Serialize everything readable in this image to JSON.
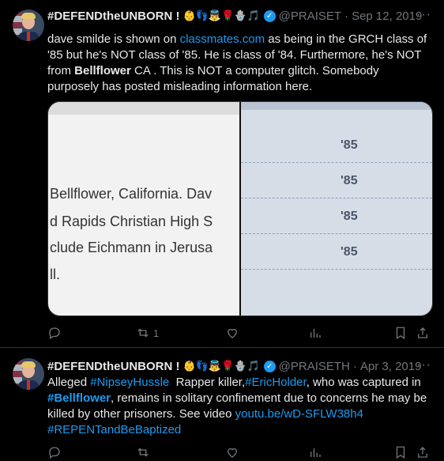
{
  "tweets": [
    {
      "name": "#DEFENDtheUNBORN !",
      "emojis": "👶👣👼🌹🪬🎵",
      "handle": "@PRAISET",
      "date": "Sep 12, 2019",
      "text_parts": [
        "dave smilde is shown on ",
        "classmates.com",
        " as being in the GRCH class of '85 but he's NOT class of '85. He is class of '84. Furthermore, he's NOT from ",
        "Bellflower",
        " CA . This is NOT a computer glitch. Somebody purposely has posted misleading information here."
      ],
      "media": {
        "left_lines": [
          "Bellflower, California. Dav",
          "d Rapids Christian High S",
          "clude Eichmann in Jerusa",
          "ll."
        ],
        "right_years": [
          "'85",
          "'85",
          "'85",
          "'85"
        ]
      },
      "retweet_count": "1"
    },
    {
      "name": "#DEFENDtheUNBORN !",
      "emojis": "👶👣👼🌹🪬🎵",
      "handle": "@PRAISETH",
      "date": "Apr 3, 2019",
      "text_parts": [
        "Alleged ",
        "#NipseyHussle",
        "  Rapper killer,",
        "#EricHolder",
        ", who was captured in ",
        "#Bellflower",
        ", remains in solitary confinement due to concerns he may be killed by other prisoners. See video ",
        "youtu.be/wD-SFLW38h4",
        " ",
        "#REPENTandBeBaptized"
      ]
    }
  ],
  "icons": {
    "more": "more-dots-icon",
    "reply": "reply-icon",
    "retweet": "retweet-icon",
    "like": "heart-icon",
    "views": "views-icon",
    "bookmark": "bookmark-icon",
    "share": "share-icon",
    "verified": "verified-icon"
  },
  "colors": {
    "link": "#1d9bf0",
    "muted": "#71767b",
    "text": "#e7e9ea",
    "background": "#000000"
  }
}
